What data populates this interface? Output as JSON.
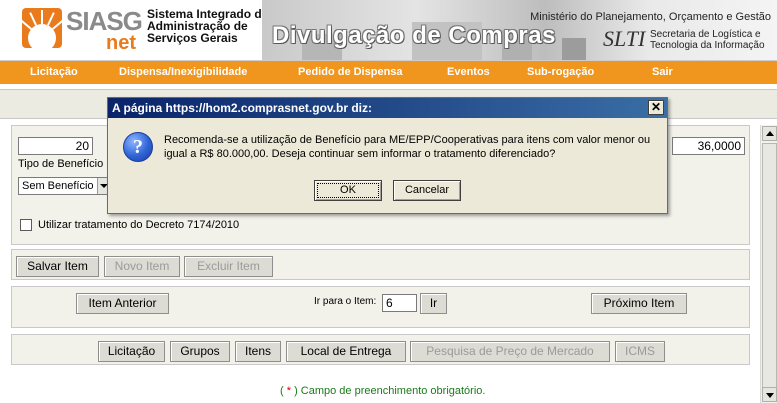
{
  "header": {
    "logo_text": "SIASG",
    "logo_sub": "net",
    "system_name_line1": "Sistema Integrado de",
    "system_name_line2": "Administração de",
    "system_name_line3": "Serviços Gerais",
    "banner_title": "Divulgação de Compras",
    "ministry": "Ministério do Planejamento, Orçamento e Gestão",
    "slti_logo": "SLTI",
    "slti_line1": "Secretaria de Logística e",
    "slti_line2": "Tecnologia da Informação"
  },
  "menu": {
    "items": [
      "Licitação",
      "Dispensa/Inexigibilidade",
      "Pedido de Dispensa",
      "Eventos",
      "Sub-rogação",
      "Sair"
    ]
  },
  "form": {
    "quantity_value": "20",
    "value_field": "36,0000",
    "benefit_label": "Tipo de Benefício",
    "benefit_selected": "Sem Benefício",
    "decree_label": "Utilizar tratamento do Decreto 7174/2010",
    "decree_checked": false
  },
  "actions": {
    "save": "Salvar Item",
    "new": "Novo Item",
    "delete": "Excluir Item"
  },
  "navigation": {
    "previous": "Item Anterior",
    "goto_label": "Ir para o Item:",
    "goto_value": "6",
    "go": "Ir",
    "next": "Próximo Item"
  },
  "tabs": {
    "items": [
      "Licitação",
      "Grupos",
      "Itens",
      "Local de Entrega",
      "Pesquisa de Preço de Mercado",
      "ICMS"
    ]
  },
  "footer": {
    "required_open": "( ",
    "required_star": "*",
    "required_text": " ) Campo de preenchimento obrigatório."
  },
  "dialog": {
    "title": "A página https://hom2.comprasnet.gov.br diz:",
    "close_glyph": "✕",
    "icon_glyph": "?",
    "message": "Recomenda-se a utilização de Benefício para ME/EPP/Cooperativas para itens com valor menor ou igual a R$ 80.000,00. Deseja continuar sem informar o tratamento diferenciado?",
    "ok": "OK",
    "cancel": "Cancelar"
  },
  "colors": {
    "menu_bar": "#f0951d",
    "dialog_title_bar": "#0a246a",
    "required_note": "#1a7a1a"
  }
}
